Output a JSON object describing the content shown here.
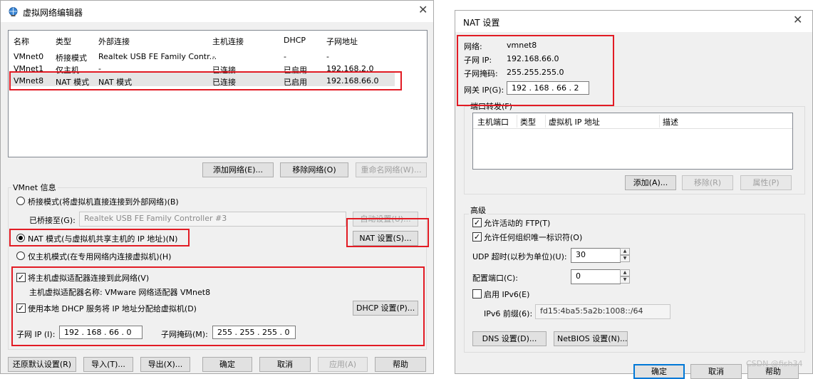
{
  "left_window": {
    "title": "虚拟网络编辑器",
    "columns": [
      "名称",
      "类型",
      "外部连接",
      "主机连接",
      "DHCP",
      "子网地址"
    ],
    "rows": [
      [
        "VMnet0",
        "桥接模式",
        "Realtek USB FE Family Contr...",
        "-",
        "-",
        "-"
      ],
      [
        "VMnet1",
        "仅主机...",
        "-",
        "已连接",
        "已启用",
        "192.168.2.0"
      ],
      [
        "VMnet8",
        "NAT 模式",
        "NAT 模式",
        "已连接",
        "已启用",
        "192.168.66.0"
      ]
    ],
    "add_network": "添加网络(E)...",
    "remove_network": "移除网络(O)",
    "rename_network": "重命名网络(W)...",
    "vmnet_info": "VMnet 信息",
    "bridged_mode": "桥接模式(将虚拟机直接连接到外部网络)(B)",
    "bridged_to_label": "已桥接至(G):",
    "bridged_to_value": "Realtek USB FE Family Controller #3",
    "auto_settings": "自动设置(U)...",
    "nat_mode": "NAT 模式(与虚拟机共享主机的 IP 地址)(N)",
    "nat_settings": "NAT 设置(S)...",
    "host_only": "仅主机模式(在专用网络内连接虚拟机)(H)",
    "connect_adapter": "将主机虚拟适配器连接到此网络(V)",
    "adapter_name": "主机虚拟适配器名称: VMware 网络适配器 VMnet8",
    "use_dhcp": "使用本地 DHCP 服务将 IP 地址分配给虚拟机(D)",
    "dhcp_settings": "DHCP 设置(P)...",
    "subnet_ip_label": "子网 IP (I):",
    "subnet_ip": "192 . 168 . 66 . 0",
    "subnet_mask_label": "子网掩码(M):",
    "subnet_mask": "255 . 255 . 255 . 0",
    "restore_defaults": "还原默认设置(R)",
    "import": "导入(T)...",
    "export": "导出(X)...",
    "ok": "确定",
    "cancel": "取消",
    "apply": "应用(A)",
    "help": "帮助"
  },
  "right_window": {
    "title": "NAT 设置",
    "network_label": "网络:",
    "network_value": "vmnet8",
    "subnet_ip_label": "子网 IP:",
    "subnet_ip_value": "192.168.66.0",
    "subnet_mask_label": "子网掩码:",
    "subnet_mask_value": "255.255.255.0",
    "gateway_label": "网关 IP(G):",
    "gateway_value": "192 . 168 . 66 . 2",
    "port_forwarding": "端口转发(F)",
    "pf_columns": [
      "主机端口",
      "类型",
      "虚拟机 IP 地址",
      "描述"
    ],
    "add": "添加(A)...",
    "remove": "移除(R)",
    "properties": "属性(P)",
    "advanced": "高级",
    "allow_ftp": "允许活动的 FTP(T)",
    "allow_oui": "允许任何组织唯一标识符(O)",
    "udp_timeout_label": "UDP 超时(以秒为单位)(U):",
    "udp_timeout": "30",
    "config_port_label": "配置端口(C):",
    "config_port": "0",
    "enable_ipv6": "启用 IPv6(E)",
    "ipv6_prefix_label": "IPv6 前缀(6):",
    "ipv6_prefix": "fd15:4ba5:5a2b:1008::/64",
    "dns_settings": "DNS 设置(D)...",
    "netbios_settings": "NetBIOS 设置(N)...",
    "ok": "确定",
    "cancel": "取消",
    "help": "帮助"
  },
  "watermark": "CSDN @fish34",
  "checkmark": "✓",
  "close_glyph": "✕",
  "spin_up": "▲",
  "spin_down": "▼",
  "accent_color": "#0078d7",
  "highlight_color": "#e21b24"
}
